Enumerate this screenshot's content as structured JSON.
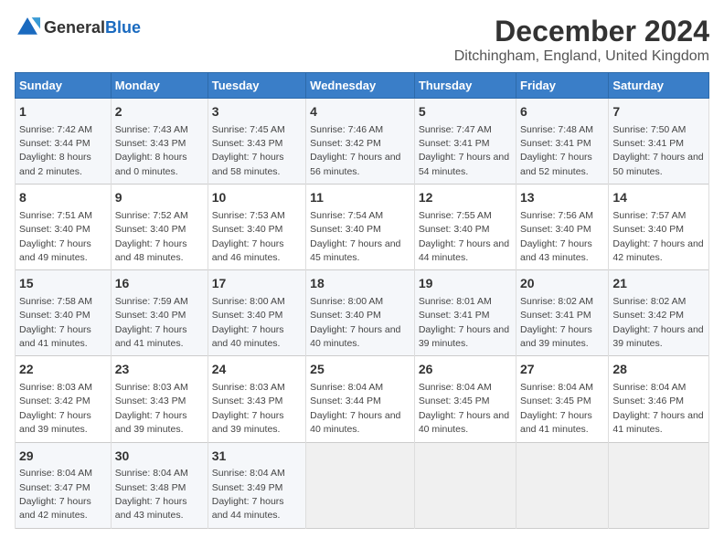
{
  "header": {
    "logo_general": "General",
    "logo_blue": "Blue",
    "title": "December 2024",
    "subtitle": "Ditchingham, England, United Kingdom"
  },
  "columns": [
    "Sunday",
    "Monday",
    "Tuesday",
    "Wednesday",
    "Thursday",
    "Friday",
    "Saturday"
  ],
  "weeks": [
    [
      {
        "day": "1",
        "sunrise": "Sunrise: 7:42 AM",
        "sunset": "Sunset: 3:44 PM",
        "daylight": "Daylight: 8 hours and 2 minutes."
      },
      {
        "day": "2",
        "sunrise": "Sunrise: 7:43 AM",
        "sunset": "Sunset: 3:43 PM",
        "daylight": "Daylight: 8 hours and 0 minutes."
      },
      {
        "day": "3",
        "sunrise": "Sunrise: 7:45 AM",
        "sunset": "Sunset: 3:43 PM",
        "daylight": "Daylight: 7 hours and 58 minutes."
      },
      {
        "day": "4",
        "sunrise": "Sunrise: 7:46 AM",
        "sunset": "Sunset: 3:42 PM",
        "daylight": "Daylight: 7 hours and 56 minutes."
      },
      {
        "day": "5",
        "sunrise": "Sunrise: 7:47 AM",
        "sunset": "Sunset: 3:41 PM",
        "daylight": "Daylight: 7 hours and 54 minutes."
      },
      {
        "day": "6",
        "sunrise": "Sunrise: 7:48 AM",
        "sunset": "Sunset: 3:41 PM",
        "daylight": "Daylight: 7 hours and 52 minutes."
      },
      {
        "day": "7",
        "sunrise": "Sunrise: 7:50 AM",
        "sunset": "Sunset: 3:41 PM",
        "daylight": "Daylight: 7 hours and 50 minutes."
      }
    ],
    [
      {
        "day": "8",
        "sunrise": "Sunrise: 7:51 AM",
        "sunset": "Sunset: 3:40 PM",
        "daylight": "Daylight: 7 hours and 49 minutes."
      },
      {
        "day": "9",
        "sunrise": "Sunrise: 7:52 AM",
        "sunset": "Sunset: 3:40 PM",
        "daylight": "Daylight: 7 hours and 48 minutes."
      },
      {
        "day": "10",
        "sunrise": "Sunrise: 7:53 AM",
        "sunset": "Sunset: 3:40 PM",
        "daylight": "Daylight: 7 hours and 46 minutes."
      },
      {
        "day": "11",
        "sunrise": "Sunrise: 7:54 AM",
        "sunset": "Sunset: 3:40 PM",
        "daylight": "Daylight: 7 hours and 45 minutes."
      },
      {
        "day": "12",
        "sunrise": "Sunrise: 7:55 AM",
        "sunset": "Sunset: 3:40 PM",
        "daylight": "Daylight: 7 hours and 44 minutes."
      },
      {
        "day": "13",
        "sunrise": "Sunrise: 7:56 AM",
        "sunset": "Sunset: 3:40 PM",
        "daylight": "Daylight: 7 hours and 43 minutes."
      },
      {
        "day": "14",
        "sunrise": "Sunrise: 7:57 AM",
        "sunset": "Sunset: 3:40 PM",
        "daylight": "Daylight: 7 hours and 42 minutes."
      }
    ],
    [
      {
        "day": "15",
        "sunrise": "Sunrise: 7:58 AM",
        "sunset": "Sunset: 3:40 PM",
        "daylight": "Daylight: 7 hours and 41 minutes."
      },
      {
        "day": "16",
        "sunrise": "Sunrise: 7:59 AM",
        "sunset": "Sunset: 3:40 PM",
        "daylight": "Daylight: 7 hours and 41 minutes."
      },
      {
        "day": "17",
        "sunrise": "Sunrise: 8:00 AM",
        "sunset": "Sunset: 3:40 PM",
        "daylight": "Daylight: 7 hours and 40 minutes."
      },
      {
        "day": "18",
        "sunrise": "Sunrise: 8:00 AM",
        "sunset": "Sunset: 3:40 PM",
        "daylight": "Daylight: 7 hours and 40 minutes."
      },
      {
        "day": "19",
        "sunrise": "Sunrise: 8:01 AM",
        "sunset": "Sunset: 3:41 PM",
        "daylight": "Daylight: 7 hours and 39 minutes."
      },
      {
        "day": "20",
        "sunrise": "Sunrise: 8:02 AM",
        "sunset": "Sunset: 3:41 PM",
        "daylight": "Daylight: 7 hours and 39 minutes."
      },
      {
        "day": "21",
        "sunrise": "Sunrise: 8:02 AM",
        "sunset": "Sunset: 3:42 PM",
        "daylight": "Daylight: 7 hours and 39 minutes."
      }
    ],
    [
      {
        "day": "22",
        "sunrise": "Sunrise: 8:03 AM",
        "sunset": "Sunset: 3:42 PM",
        "daylight": "Daylight: 7 hours and 39 minutes."
      },
      {
        "day": "23",
        "sunrise": "Sunrise: 8:03 AM",
        "sunset": "Sunset: 3:43 PM",
        "daylight": "Daylight: 7 hours and 39 minutes."
      },
      {
        "day": "24",
        "sunrise": "Sunrise: 8:03 AM",
        "sunset": "Sunset: 3:43 PM",
        "daylight": "Daylight: 7 hours and 39 minutes."
      },
      {
        "day": "25",
        "sunrise": "Sunrise: 8:04 AM",
        "sunset": "Sunset: 3:44 PM",
        "daylight": "Daylight: 7 hours and 40 minutes."
      },
      {
        "day": "26",
        "sunrise": "Sunrise: 8:04 AM",
        "sunset": "Sunset: 3:45 PM",
        "daylight": "Daylight: 7 hours and 40 minutes."
      },
      {
        "day": "27",
        "sunrise": "Sunrise: 8:04 AM",
        "sunset": "Sunset: 3:45 PM",
        "daylight": "Daylight: 7 hours and 41 minutes."
      },
      {
        "day": "28",
        "sunrise": "Sunrise: 8:04 AM",
        "sunset": "Sunset: 3:46 PM",
        "daylight": "Daylight: 7 hours and 41 minutes."
      }
    ],
    [
      {
        "day": "29",
        "sunrise": "Sunrise: 8:04 AM",
        "sunset": "Sunset: 3:47 PM",
        "daylight": "Daylight: 7 hours and 42 minutes."
      },
      {
        "day": "30",
        "sunrise": "Sunrise: 8:04 AM",
        "sunset": "Sunset: 3:48 PM",
        "daylight": "Daylight: 7 hours and 43 minutes."
      },
      {
        "day": "31",
        "sunrise": "Sunrise: 8:04 AM",
        "sunset": "Sunset: 3:49 PM",
        "daylight": "Daylight: 7 hours and 44 minutes."
      },
      null,
      null,
      null,
      null
    ]
  ]
}
